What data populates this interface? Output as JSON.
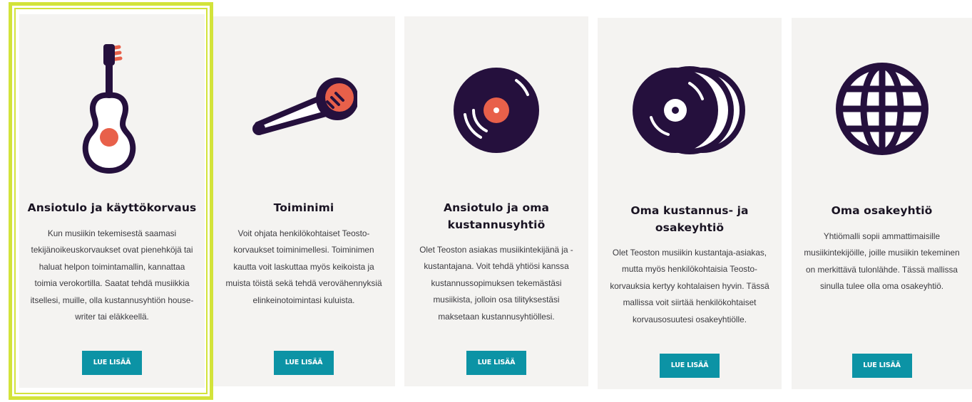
{
  "colors": {
    "dark": "#25103d",
    "accent": "#e8604a",
    "button": "#0c93a5",
    "highlight": "#d3e33a",
    "card_bg": "#f4f3f1"
  },
  "cards": [
    {
      "icon": "guitar-icon",
      "title": "Ansiotulo ja käyttökorvaus",
      "text": "Kun musiikin tekemisestä saamasi tekijänoikeuskorvaukset ovat pienehköjä tai haluat helpon toimintamallin, kannattaa toimia verokortilla. Saatat tehdä musiikkia itsellesi, muille, olla kustannusyhtiön house-writer tai eläkkeellä.",
      "button": "LUE LISÄÄ"
    },
    {
      "icon": "microphone-icon",
      "title": "Toiminimi",
      "text": "Voit ohjata henkilökohtaiset Teosto-korvaukset toiminimellesi. Toiminimen kautta voit laskuttaa myös keikoista ja muista töistä sekä tehdä verovähennyksiä elinkeinotoimintasi kuluista.",
      "button": "LUE LISÄÄ"
    },
    {
      "icon": "vinyl-record-icon",
      "title": "Ansiotulo ja oma kustannusyhtiö",
      "text": "Olet Teoston asiakas musiikintekijänä ja -kustantajana. Voit tehdä yhtiösi kanssa kustannussopimuksen tekemästäsi musiikista, jolloin osa tilityksestäsi maksetaan kustannusyhtiöllesi.",
      "button": "LUE LISÄÄ"
    },
    {
      "icon": "stacked-records-icon",
      "title": "Oma kustannus- ja osakeyhtiö",
      "text": "Olet Teoston musiikin kustantaja-asiakas, mutta myös henkilökohtaisia Teosto-korvauksia kertyy kohtalaisen hyvin. Tässä mallissa voit siirtää henkilökohtaiset korvausosuutesi osakeyhtiölle.",
      "button": "LUE LISÄÄ"
    },
    {
      "icon": "globe-icon",
      "title": "Oma osakeyhtiö",
      "text": "Yhtiömalli sopii ammattimaisille musiikintekijöille, joille musiikin tekeminen on merkittävä tulonlähde. Tässä mallissa sinulla tulee olla oma osakeyhtiö.",
      "button": "LUE LISÄÄ"
    }
  ]
}
